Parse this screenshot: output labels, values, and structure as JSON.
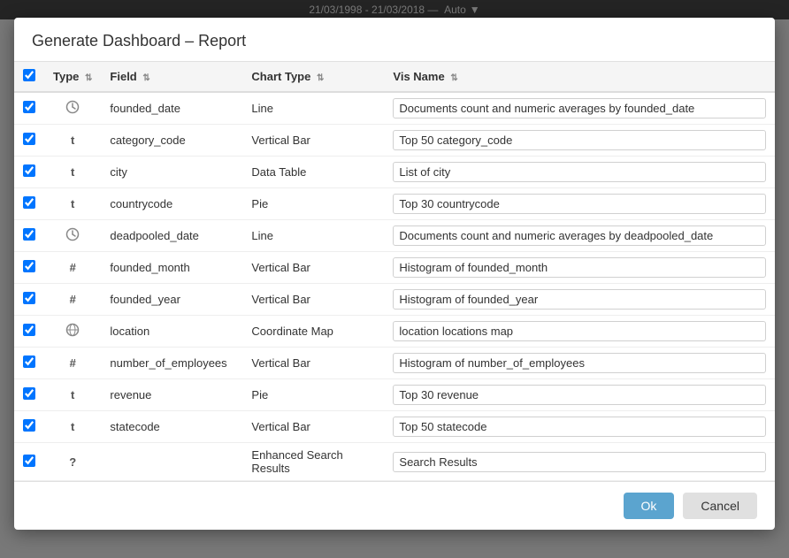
{
  "topbar": {
    "daterange": "21/03/1998 - 21/03/2018 —",
    "mode": "Auto"
  },
  "modal": {
    "title": "Generate Dashboard – Report",
    "columns": {
      "type": "Type",
      "field": "Field",
      "chart_type": "Chart Type",
      "vis_name": "Vis Name"
    },
    "rows": [
      {
        "checked": true,
        "type": "clock",
        "field": "founded_date",
        "chart_type": "Line",
        "vis_name": "Documents count and numeric averages by founded_date"
      },
      {
        "checked": true,
        "type": "t",
        "field": "category_code",
        "chart_type": "Vertical Bar",
        "vis_name": "Top 50 category_code"
      },
      {
        "checked": true,
        "type": "t",
        "field": "city",
        "chart_type": "Data Table",
        "vis_name": "List of city"
      },
      {
        "checked": true,
        "type": "t",
        "field": "countrycode",
        "chart_type": "Pie",
        "vis_name": "Top 30 countrycode"
      },
      {
        "checked": true,
        "type": "clock",
        "field": "deadpooled_date",
        "chart_type": "Line",
        "vis_name": "Documents count and numeric averages by deadpooled_date"
      },
      {
        "checked": true,
        "type": "#",
        "field": "founded_month",
        "chart_type": "Vertical Bar",
        "vis_name": "Histogram of founded_month"
      },
      {
        "checked": true,
        "type": "#",
        "field": "founded_year",
        "chart_type": "Vertical Bar",
        "vis_name": "Histogram of founded_year"
      },
      {
        "checked": true,
        "type": "globe",
        "field": "location",
        "chart_type": "Coordinate Map",
        "vis_name": "location locations map"
      },
      {
        "checked": true,
        "type": "#",
        "field": "number_of_employees",
        "chart_type": "Vertical Bar",
        "vis_name": "Histogram of number_of_employees"
      },
      {
        "checked": true,
        "type": "t",
        "field": "revenue",
        "chart_type": "Pie",
        "vis_name": "Top 30 revenue"
      },
      {
        "checked": true,
        "type": "t",
        "field": "statecode",
        "chart_type": "Vertical Bar",
        "vis_name": "Top 50 statecode"
      },
      {
        "checked": true,
        "type": "?",
        "field": "",
        "chart_type": "Enhanced Search Results",
        "vis_name": "Search Results"
      }
    ],
    "buttons": {
      "ok": "Ok",
      "cancel": "Cancel"
    }
  }
}
